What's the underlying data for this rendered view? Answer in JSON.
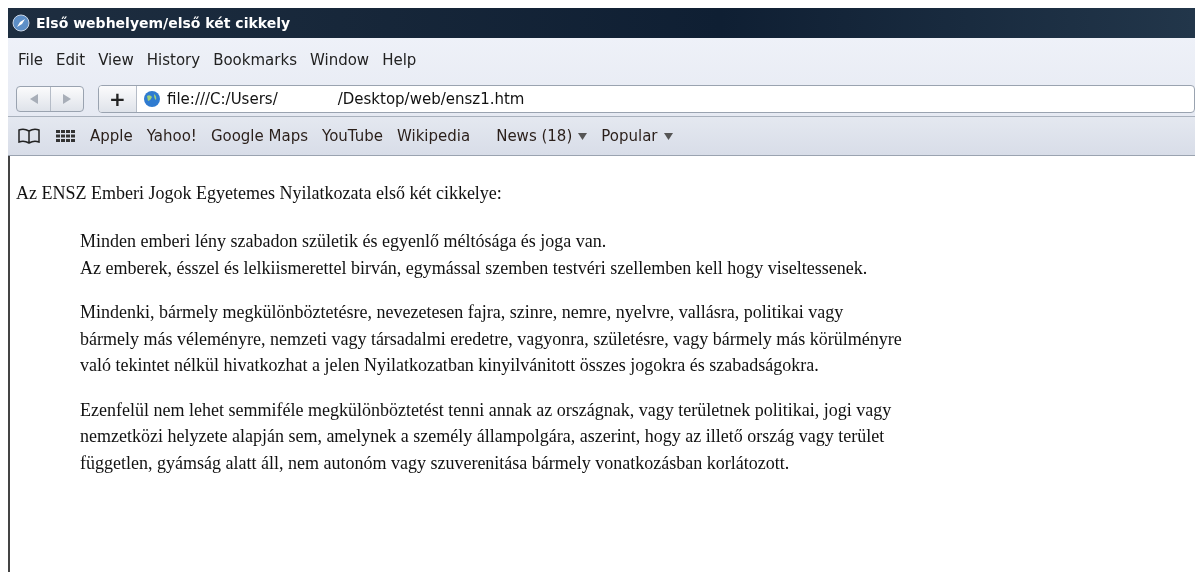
{
  "window": {
    "title": "Első webhelyem/első két cikkely"
  },
  "menu": [
    "File",
    "Edit",
    "View",
    "History",
    "Bookmarks",
    "Window",
    "Help"
  ],
  "toolbar": {
    "back": {
      "disabled": true
    },
    "forward": {
      "disabled": true
    },
    "new_tab": "+",
    "url_parts": [
      "file:///C:/Users/",
      "/Desktop/web/ensz1.htm"
    ]
  },
  "bookmarks": [
    {
      "label": "Apple",
      "menu": false
    },
    {
      "label": "Yahoo!",
      "menu": false
    },
    {
      "label": "Google Maps",
      "menu": false
    },
    {
      "label": "YouTube",
      "menu": false
    },
    {
      "label": "Wikipedia",
      "menu": false
    },
    {
      "label": "News (18)",
      "menu": true
    },
    {
      "label": "Popular",
      "menu": true
    }
  ],
  "page": {
    "heading": "Az ENSZ Emberi Jogok Egyetemes Nyilatkozata első két cikkelye:",
    "paragraphs": [
      [
        "Minden emberi lény szabadon születik és egyenlő méltósága és joga van.",
        "Az emberek, ésszel és lelkiismerettel birván, egymással szemben testvéri szellemben kell hogy viseltessenek."
      ],
      [
        "Mindenki, bármely megkülönböztetésre, nevezetesen fajra, szinre, nemre, nyelvre, vallásra, politikai vagy",
        "bármely más véleményre, nemzeti vagy társadalmi eredetre, vagyonra, születésre, vagy bármely más körülményre",
        "való tekintet nélkül hivatkozhat a jelen Nyilatkozatban kinyilvánitott összes jogokra és szabadságokra."
      ],
      [
        "Ezenfelül nem lehet semmiféle megkülönböztetést tenni annak az országnak, vagy területnek politikai, jogi vagy",
        "nemzetközi helyzete alapján sem, amelynek a személy állampolgára, aszerint, hogy az illető ország vagy terület",
        "független, gyámság alatt áll, nem autonóm vagy szuverenitása bármely vonatkozásban korlátozott."
      ]
    ]
  }
}
